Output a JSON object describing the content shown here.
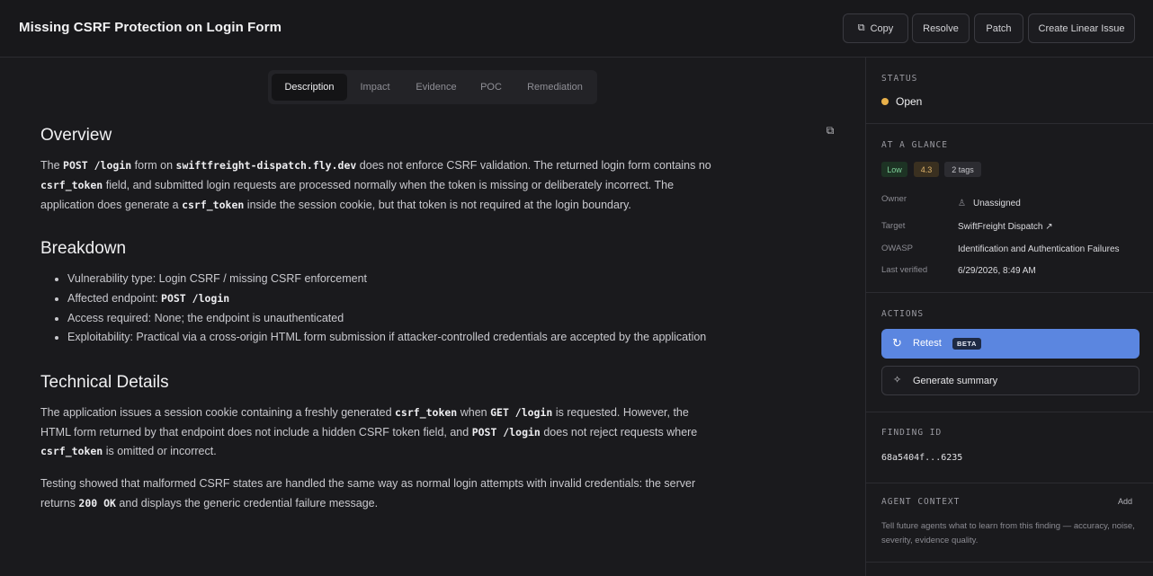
{
  "header": {
    "title": "Missing CSRF Protection on Login Form",
    "buttons": {
      "copy": "Copy",
      "resolve": "Resolve",
      "patch": "Patch",
      "linear": "Create Linear Issue"
    }
  },
  "tabs": [
    "Description",
    "Impact",
    "Evidence",
    "POC",
    "Remediation"
  ],
  "overview": {
    "heading": "Overview",
    "t1": "The ",
    "c1": "POST /login",
    "t2": " form on ",
    "c2": "swiftfreight-dispatch.fly.dev",
    "t3": " does not enforce CSRF validation. The returned login form contains no ",
    "c3": "csrf_token",
    "t4": " field, and submitted login requests are processed normally when the token is missing or deliberately incorrect. The application does generate a ",
    "c4": "csrf_token",
    "t5": " inside the session cookie, but that token is not required at the login boundary."
  },
  "breakdown": {
    "heading": "Breakdown",
    "item1": "Vulnerability type: Login CSRF / missing CSRF enforcement",
    "item2_label": "Affected endpoint: ",
    "item2_code": "POST /login",
    "item3": "Access required: None; the endpoint is unauthenticated",
    "item4": "Exploitability: Practical via a cross-origin HTML form submission if attacker-controlled credentials are accepted by the application"
  },
  "technical": {
    "heading": "Technical Details",
    "p1_t1": "The application issues a session cookie containing a freshly generated ",
    "p1_c1": "csrf_token",
    "p1_t2": " when ",
    "p1_c2": "GET /login",
    "p1_t3": " is requested. However, the HTML form returned by that endpoint does not include a hidden CSRF token field, and ",
    "p1_c3": "POST /login",
    "p1_t4": " does not reject requests where ",
    "p1_c4": "csrf_token",
    "p1_t5": " is omitted or incorrect.",
    "p2_t1": "Testing showed that malformed CSRF states are handled the same way as normal login attempts with invalid credentials: the server returns ",
    "p2_c1": "200 OK",
    "p2_t2": " and displays the generic credential failure message."
  },
  "sidebar": {
    "status_label": "STATUS",
    "status_value": "Open",
    "status_color": "#e8b04a",
    "glance_label": "AT A GLANCE",
    "badges": {
      "severity": "Low",
      "score": "4.3",
      "tags": "2 tags"
    },
    "owner_label": "Owner",
    "owner_value": "Unassigned",
    "target_label": "Target",
    "target_value": "SwiftFreight Dispatch ↗",
    "owasp_label": "OWASP",
    "owasp_value": "Identification and Authentication Failures",
    "verified_label": "Last verified",
    "verified_value": "6/29/2026, 8:49 AM",
    "actions_label": "ACTIONS",
    "retest": "Retest",
    "beta": "BETA",
    "summary": "Generate summary",
    "finding_label": "FINDING ID",
    "finding_value": "68a5404f...6235",
    "agent_label": "AGENT CONTEXT",
    "agent_add": "Add",
    "agent_desc": "Tell future agents what to learn from this finding — accuracy, noise, severity, evidence quality."
  }
}
